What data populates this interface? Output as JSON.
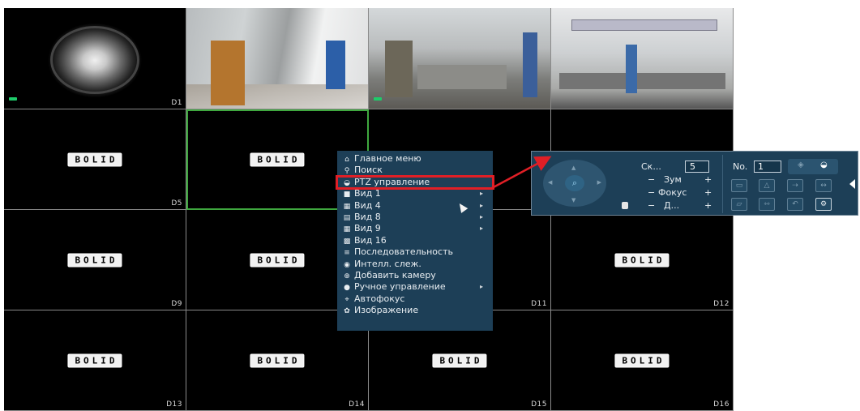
{
  "cells": [
    {
      "label": "D1",
      "type": "live"
    },
    {
      "label": "",
      "type": "live"
    },
    {
      "label": "",
      "type": "live"
    },
    {
      "label": "",
      "type": "live"
    },
    {
      "label": "D5",
      "type": "logo"
    },
    {
      "label": "",
      "type": "logo"
    },
    {
      "label": "",
      "type": "logo"
    },
    {
      "label": "",
      "type": "logo"
    },
    {
      "label": "D9",
      "type": "logo"
    },
    {
      "label": "",
      "type": "logo"
    },
    {
      "label": "D11",
      "type": "logo"
    },
    {
      "label": "D12",
      "type": "logo"
    },
    {
      "label": "D13",
      "type": "logo"
    },
    {
      "label": "D14",
      "type": "logo"
    },
    {
      "label": "D15",
      "type": "logo"
    },
    {
      "label": "D16",
      "type": "logo"
    }
  ],
  "brand_logo": "BOLID",
  "context_menu": {
    "items": [
      {
        "icon": "home-icon",
        "label": "Главное меню",
        "submenu": false
      },
      {
        "icon": "search-icon",
        "label": "Поиск",
        "submenu": false
      },
      {
        "icon": "ptz-icon",
        "label": "PTZ управление",
        "submenu": false,
        "highlighted": true
      },
      {
        "icon": "view-1-icon",
        "label": "Вид 1",
        "submenu": true
      },
      {
        "icon": "view-4-icon",
        "label": "Вид 4",
        "submenu": true
      },
      {
        "icon": "view-8-icon",
        "label": "Вид 8",
        "submenu": true
      },
      {
        "icon": "view-9-icon",
        "label": "Вид 9",
        "submenu": true
      },
      {
        "icon": "view-16-icon",
        "label": "Вид 16",
        "submenu": false
      },
      {
        "icon": "sequence-icon",
        "label": "Последовательность",
        "submenu": false
      },
      {
        "icon": "smart-track-icon",
        "label": "Интелл. слеж.",
        "submenu": false
      },
      {
        "icon": "add-camera-icon",
        "label": "Добавить камеру",
        "submenu": false
      },
      {
        "icon": "manual-control-icon",
        "label": "Ручное управление",
        "submenu": true
      },
      {
        "icon": "autofocus-icon",
        "label": "Автофокус",
        "submenu": false
      },
      {
        "icon": "image-icon",
        "label": "Изображение",
        "submenu": false
      }
    ]
  },
  "ptz_panel": {
    "speed_label": "Ск...",
    "speed_value": "5",
    "zoom_label": "Зум",
    "focus_label": "Фокус",
    "iris_label": "Д...",
    "minus": "−",
    "plus": "+",
    "no_label": "No.",
    "no_value": "1"
  },
  "colors": {
    "menu_bg": "#1d3f57",
    "highlight": "#e01f26",
    "selection": "#3fa83f",
    "rec_indicator": "#1ecb6a"
  }
}
